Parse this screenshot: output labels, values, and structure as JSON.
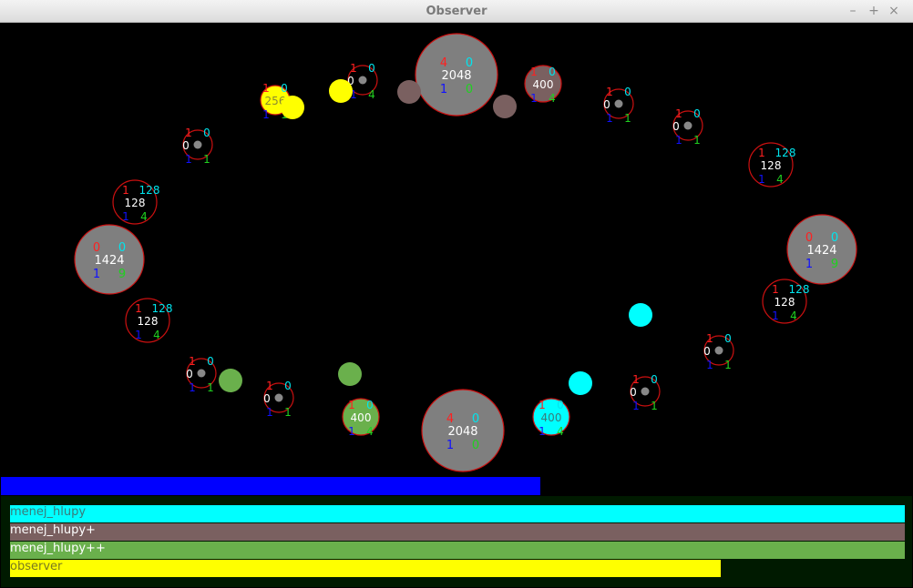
{
  "window": {
    "title": "Observer",
    "controls": {
      "minimize": "–",
      "maximize": "+",
      "close": "×"
    }
  },
  "colors": {
    "background": "#000000",
    "neutral": "#7f7f7f",
    "ring": "#cc1010",
    "ring_fill_small": "#000000",
    "menej_hlupy": "#00ffff",
    "menej_hlupy_plus": "#7a6060",
    "menej_hlupy_plusplus": "#6ab04c",
    "observer": "#ffff00",
    "top_bar": "#0000ff",
    "bottom_panel": "#001a00"
  },
  "top_bar": {
    "fraction": 0.592
  },
  "cells": [
    {
      "id": "top-big",
      "owner": "neutral",
      "r": 45,
      "red": "4",
      "cyan": "0",
      "white": "2048",
      "blue": "1",
      "green": "0"
    },
    {
      "id": "bottom-big",
      "owner": "neutral",
      "r": 45,
      "red": "4",
      "cyan": "0",
      "white": "2048",
      "blue": "1",
      "green": "0"
    },
    {
      "id": "left-big",
      "owner": "neutral",
      "r": 38,
      "red": "0",
      "cyan": "0",
      "white": "1424",
      "blue": "1",
      "green": "9"
    },
    {
      "id": "right-big",
      "owner": "neutral",
      "r": 38,
      "red": "0",
      "cyan": "0",
      "white": "1424",
      "blue": "1",
      "green": "9"
    },
    {
      "id": "brown-400",
      "owner": "menej_hlupy_plus",
      "r": 20,
      "red": "1",
      "cyan": "0",
      "white": "400",
      "blue": "1",
      "green": "4"
    },
    {
      "id": "green-400",
      "owner": "menej_hlupy_plusplus",
      "r": 20,
      "red": "1",
      "cyan": "0",
      "white": "400",
      "blue": "1",
      "green": "4"
    },
    {
      "id": "cyan-400",
      "owner": "menej_hlupy",
      "r": 20,
      "red": "1",
      "cyan": "0",
      "white": "400",
      "blue": "1",
      "green": "4"
    },
    {
      "id": "yellow-256",
      "owner": "observer",
      "r": 16,
      "red": "1",
      "cyan": "0",
      "white": "256",
      "blue": "1",
      "green": "1"
    },
    {
      "id": "s1",
      "owner": "empty",
      "r": 16,
      "red": "1",
      "cyan": "0",
      "white": "0",
      "blue": "1",
      "green": "4"
    },
    {
      "id": "s2",
      "owner": "empty",
      "r": 16,
      "red": "1",
      "cyan": "0",
      "white": "0",
      "blue": "1",
      "green": "1"
    },
    {
      "id": "s3",
      "owner": "empty",
      "r": 16,
      "red": "1",
      "cyan": "0",
      "white": "0",
      "blue": "1",
      "green": "1"
    },
    {
      "id": "s4",
      "owner": "empty",
      "r": 16,
      "red": "1",
      "cyan": "0",
      "white": "0",
      "blue": "1",
      "green": "1"
    },
    {
      "id": "s5",
      "owner": "empty",
      "r": 16,
      "red": "1",
      "cyan": "0",
      "white": "0",
      "blue": "1",
      "green": "1"
    },
    {
      "id": "s6",
      "owner": "empty",
      "r": 16,
      "red": "1",
      "cyan": "0",
      "white": "0",
      "blue": "1",
      "green": "1"
    },
    {
      "id": "s7",
      "owner": "empty",
      "r": 16,
      "red": "1",
      "cyan": "0",
      "white": "0",
      "blue": "1",
      "green": "1"
    },
    {
      "id": "s8",
      "owner": "empty",
      "r": 16,
      "red": "1",
      "cyan": "0",
      "white": "0",
      "blue": "1",
      "green": "1"
    },
    {
      "id": "s9",
      "owner": "empty",
      "r": 16,
      "red": "1",
      "cyan": "0",
      "white": "0",
      "blue": "1",
      "green": "1"
    },
    {
      "id": "m1",
      "owner": "empty",
      "r": 24,
      "red": "1",
      "cyan": "128",
      "white": "128",
      "blue": "1",
      "green": "4"
    },
    {
      "id": "m2",
      "owner": "empty",
      "r": 24,
      "red": "1",
      "cyan": "128",
      "white": "128",
      "blue": "1",
      "green": "4"
    },
    {
      "id": "m3",
      "owner": "empty",
      "r": 24,
      "red": "1",
      "cyan": "128",
      "white": "128",
      "blue": "1",
      "green": "4"
    },
    {
      "id": "m4",
      "owner": "empty",
      "r": 24,
      "red": "1",
      "cyan": "128",
      "white": "128",
      "blue": "1",
      "green": "4"
    }
  ],
  "units": [
    {
      "id": "u1",
      "owner": "observer"
    },
    {
      "id": "u2",
      "owner": "observer"
    },
    {
      "id": "u3",
      "owner": "menej_hlupy_plus"
    },
    {
      "id": "u4",
      "owner": "menej_hlupy_plus"
    },
    {
      "id": "u5",
      "owner": "menej_hlupy"
    },
    {
      "id": "u6",
      "owner": "menej_hlupy"
    },
    {
      "id": "u7",
      "owner": "menej_hlupy_plusplus"
    },
    {
      "id": "u8",
      "owner": "menej_hlupy_plusplus"
    }
  ],
  "players": [
    {
      "name": "menej_hlupy",
      "color": "#00ffff",
      "text_color": "#3a7a7a",
      "fraction": 0.982
    },
    {
      "name": "menej_hlupy+",
      "color": "#7a6060",
      "text_color": "#ffffff",
      "fraction": 0.982
    },
    {
      "name": "menej_hlupy++",
      "color": "#6ab04c",
      "text_color": "#ffffff",
      "fraction": 0.982
    },
    {
      "name": "observer",
      "color": "#ffff00",
      "text_color": "#7a7a20",
      "fraction": 0.78
    }
  ]
}
